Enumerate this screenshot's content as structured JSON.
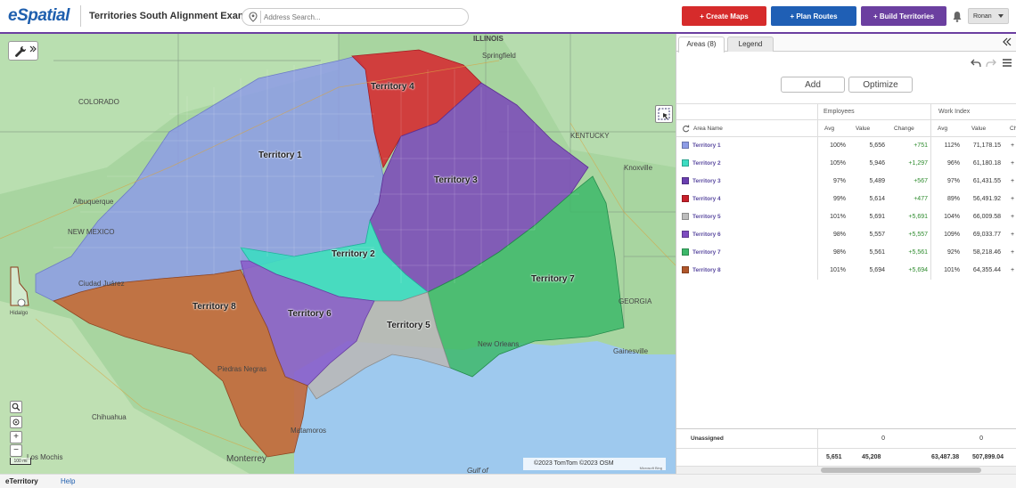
{
  "app": {
    "logo": "eSpatial",
    "title": "Territories South Alignment Example"
  },
  "search": {
    "placeholder": "Address Search..."
  },
  "header_buttons": {
    "create_maps": "+ Create Maps",
    "plan_routes": "+ Plan Routes",
    "build_territories": "+ Build Territories"
  },
  "user": {
    "name": "Ronan"
  },
  "icons": {
    "pin": "location-pin-icon",
    "bell": "bell-icon",
    "wrench": "wrench-icon",
    "undo": "undo-icon",
    "redo": "redo-icon",
    "menu": "hamburger-menu-icon",
    "refresh": "refresh-icon",
    "select": "lasso-select-icon"
  },
  "colors": {
    "brand_purple": "#6b3fa0",
    "maps_red": "#d62b2b",
    "routes_blue": "#1f5fb5",
    "water": "#9ec9ee",
    "land": "#a8d5a0"
  },
  "map": {
    "place_labels": [
      "ILLINOIS",
      "Springfield",
      "COLORADO",
      "KENTUCKY",
      "Knoxville",
      "Albuquerque",
      "NEW MEXICO",
      "Ciudad Juárez",
      "Chihuahua",
      "Hidalgo",
      "GEORGIA",
      "New Orleans",
      "Gainesville",
      "Monterrey",
      "Matamoros",
      "Piedras Negras",
      "Los Mochis",
      "Gulf of"
    ],
    "territories": [
      {
        "label": "Territory 1",
        "color": "#8d9ce6"
      },
      {
        "label": "Territory 2",
        "color": "#3ddcc2"
      },
      {
        "label": "Territory 3",
        "color": "#7b4bb8"
      },
      {
        "label": "Territory 4",
        "color": "#d42d32"
      },
      {
        "label": "Territory 5",
        "color": "#b8b8b8"
      },
      {
        "label": "Territory 6",
        "color": "#8a5cc9"
      },
      {
        "label": "Territory 7",
        "color": "#3db86a"
      },
      {
        "label": "Territory 8",
        "color": "#c2683a"
      }
    ],
    "scale": "100 mi",
    "attribution": "©2023 TomTom  ©2023 OSM",
    "ms_logo": "Microsoft Bing",
    "zoom_in": "+",
    "zoom_out": "−"
  },
  "panel": {
    "tabs": [
      {
        "label": "Areas (8)"
      },
      {
        "label": "Legend"
      }
    ],
    "add_label": "Add",
    "optimize_label": "Optimize",
    "group_headers": {
      "employees": "Employees",
      "work_index": "Work Index"
    },
    "columns": {
      "area_name": "Area Name",
      "avg": "Avg",
      "value": "Value",
      "change": "Change",
      "wi_avg": "Avg",
      "wi_value": "Value",
      "wi_more": "Ch"
    },
    "rows": [
      {
        "name": "Territory 1",
        "color": "#8d9ce6",
        "avg": "100%",
        "value": "5,656",
        "change": "+751",
        "wi_avg": "112%",
        "wi_value": "71,178.15"
      },
      {
        "name": "Territory 2",
        "color": "#3ddcc2",
        "avg": "105%",
        "value": "5,946",
        "change": "+1,297",
        "wi_avg": "96%",
        "wi_value": "61,180.18"
      },
      {
        "name": "Territory 3",
        "color": "#6a3fb0",
        "avg": "97%",
        "value": "5,489",
        "change": "+567",
        "wi_avg": "97%",
        "wi_value": "61,431.55"
      },
      {
        "name": "Territory 4",
        "color": "#c8202a",
        "avg": "99%",
        "value": "5,614",
        "change": "+477",
        "wi_avg": "89%",
        "wi_value": "56,491.92"
      },
      {
        "name": "Territory 5",
        "color": "#bdbdbd",
        "avg": "101%",
        "value": "5,691",
        "change": "+5,691",
        "wi_avg": "104%",
        "wi_value": "66,009.58"
      },
      {
        "name": "Territory 6",
        "color": "#7e4cc0",
        "avg": "98%",
        "value": "5,557",
        "change": "+5,557",
        "wi_avg": "109%",
        "wi_value": "69,033.77"
      },
      {
        "name": "Territory 7",
        "color": "#3db86a",
        "avg": "98%",
        "value": "5,561",
        "change": "+5,561",
        "wi_avg": "92%",
        "wi_value": "58,218.46"
      },
      {
        "name": "Territory 8",
        "color": "#b0562a",
        "avg": "101%",
        "value": "5,694",
        "change": "+5,694",
        "wi_avg": "101%",
        "wi_value": "64,355.44"
      }
    ],
    "unassigned": {
      "label": "Unassigned",
      "value": "0",
      "wi_value": "0"
    },
    "totals": {
      "avg": "5,651",
      "value": "45,208",
      "wi_avg": "63,487.38",
      "wi_value": "507,899.04"
    }
  },
  "footer": {
    "logo": "eTerritory",
    "help": "Help"
  }
}
